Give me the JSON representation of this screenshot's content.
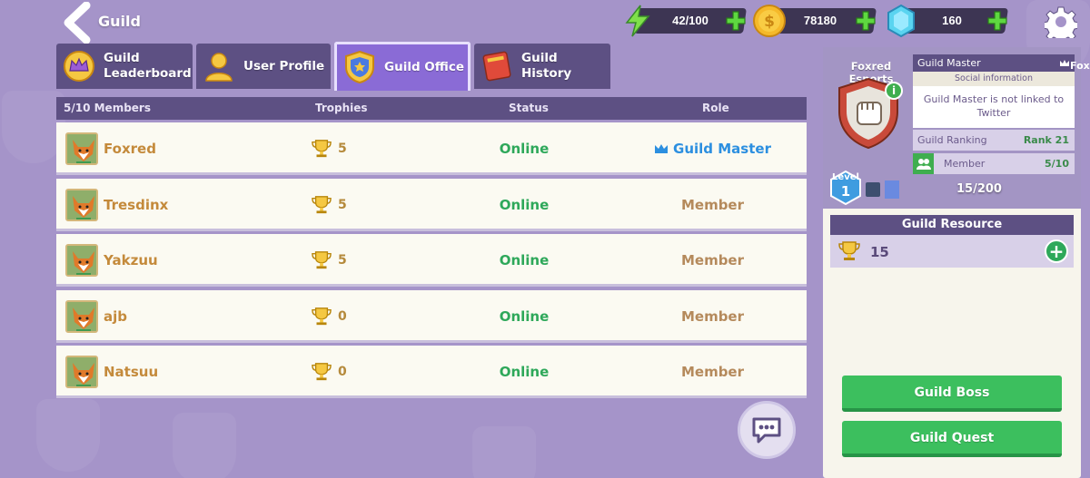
{
  "header": {
    "title": "Guild",
    "energy": "42/100",
    "coins": "78180",
    "gems": "160"
  },
  "tabs": [
    {
      "label": "Guild Leaderboard",
      "active": false
    },
    {
      "label": "User Profile",
      "active": false
    },
    {
      "label": "Guild Office",
      "active": true
    },
    {
      "label": "Guild History",
      "active": false
    }
  ],
  "members_table": {
    "count_label": "5/10 Members",
    "col_trophies": "Trophies",
    "col_status": "Status",
    "col_role": "Role",
    "rows": [
      {
        "name": "Foxred",
        "trophies": "5",
        "status": "Online",
        "role": "Guild Master"
      },
      {
        "name": "Tresdinx",
        "trophies": "5",
        "status": "Online",
        "role": "Member"
      },
      {
        "name": "Yakzuu",
        "trophies": "5",
        "status": "Online",
        "role": "Member"
      },
      {
        "name": "ajb",
        "trophies": "0",
        "status": "Online",
        "role": "Member"
      },
      {
        "name": "Natsuu",
        "trophies": "0",
        "status": "Online",
        "role": "Member"
      }
    ]
  },
  "guild_info": {
    "name": "Foxred Esports",
    "guild_master_label": "Guild Master",
    "guild_master_value": "Foxred",
    "social_title": "Social information",
    "social_text": "Guild Master is not linked to Twitter",
    "ranking_label": "Guild Ranking",
    "ranking_value": "Rank 21",
    "member_label": "Member",
    "member_value": "5/10",
    "level_label": "Level",
    "level_value": "1",
    "xp": "15/200",
    "xp_fraction": 0.075
  },
  "guild_resource": {
    "title": "Guild Resource",
    "value": "15"
  },
  "actions": {
    "boss": "Guild Boss",
    "quest": "Guild Quest"
  },
  "colors": {
    "background": "#a594c9",
    "header_bar": "#5d5083",
    "online": "#2ea85a",
    "guild_master_role": "#2c8fe0",
    "button_green": "#3cbf5e"
  }
}
